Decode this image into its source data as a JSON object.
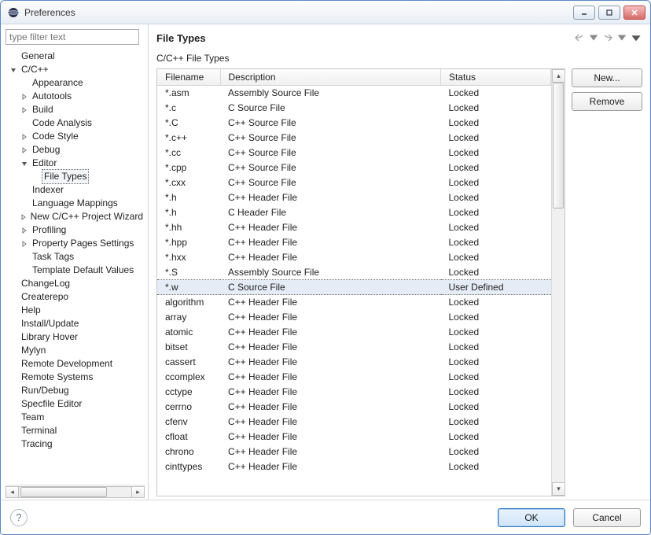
{
  "window": {
    "title": "Preferences"
  },
  "filter": {
    "placeholder": "type filter text"
  },
  "tree": [
    {
      "label": "General",
      "level": 1,
      "expander": "none"
    },
    {
      "label": "C/C++",
      "level": 1,
      "expander": "open"
    },
    {
      "label": "Appearance",
      "level": 2,
      "expander": "none"
    },
    {
      "label": "Autotools",
      "level": 2,
      "expander": "closed"
    },
    {
      "label": "Build",
      "level": 2,
      "expander": "closed"
    },
    {
      "label": "Code Analysis",
      "level": 2,
      "expander": "none"
    },
    {
      "label": "Code Style",
      "level": 2,
      "expander": "closed"
    },
    {
      "label": "Debug",
      "level": 2,
      "expander": "closed"
    },
    {
      "label": "Editor",
      "level": 2,
      "expander": "open"
    },
    {
      "label": "File Types",
      "level": 3,
      "expander": "none",
      "selected": true
    },
    {
      "label": "Indexer",
      "level": 2,
      "expander": "none"
    },
    {
      "label": "Language Mappings",
      "level": 2,
      "expander": "none"
    },
    {
      "label": "New C/C++ Project Wizard",
      "level": 2,
      "expander": "closed"
    },
    {
      "label": "Profiling",
      "level": 2,
      "expander": "closed"
    },
    {
      "label": "Property Pages Settings",
      "level": 2,
      "expander": "closed"
    },
    {
      "label": "Task Tags",
      "level": 2,
      "expander": "none"
    },
    {
      "label": "Template Default Values",
      "level": 2,
      "expander": "none"
    },
    {
      "label": "ChangeLog",
      "level": 1,
      "expander": "none"
    },
    {
      "label": "Createrepo",
      "level": 1,
      "expander": "none"
    },
    {
      "label": "Help",
      "level": 1,
      "expander": "none"
    },
    {
      "label": "Install/Update",
      "level": 1,
      "expander": "none"
    },
    {
      "label": "Library Hover",
      "level": 1,
      "expander": "none"
    },
    {
      "label": "Mylyn",
      "level": 1,
      "expander": "none"
    },
    {
      "label": "Remote Development",
      "level": 1,
      "expander": "none"
    },
    {
      "label": "Remote Systems",
      "level": 1,
      "expander": "none"
    },
    {
      "label": "Run/Debug",
      "level": 1,
      "expander": "none"
    },
    {
      "label": "Specfile Editor",
      "level": 1,
      "expander": "none"
    },
    {
      "label": "Team",
      "level": 1,
      "expander": "none"
    },
    {
      "label": "Terminal",
      "level": 1,
      "expander": "none"
    },
    {
      "label": "Tracing",
      "level": 1,
      "expander": "none"
    }
  ],
  "page": {
    "title": "File Types",
    "subtitle": "C/C++ File Types",
    "columns": {
      "filename": "Filename",
      "description": "Description",
      "status": "Status"
    },
    "rows": [
      {
        "filename": "*.asm",
        "description": "Assembly Source File",
        "status": "Locked"
      },
      {
        "filename": "*.c",
        "description": "C Source File",
        "status": "Locked"
      },
      {
        "filename": "*.C",
        "description": "C++ Source File",
        "status": "Locked"
      },
      {
        "filename": "*.c++",
        "description": "C++ Source File",
        "status": "Locked"
      },
      {
        "filename": "*.cc",
        "description": "C++ Source File",
        "status": "Locked"
      },
      {
        "filename": "*.cpp",
        "description": "C++ Source File",
        "status": "Locked"
      },
      {
        "filename": "*.cxx",
        "description": "C++ Source File",
        "status": "Locked"
      },
      {
        "filename": "*.h",
        "description": "C++ Header File",
        "status": "Locked"
      },
      {
        "filename": "*.h",
        "description": "C Header File",
        "status": "Locked"
      },
      {
        "filename": "*.hh",
        "description": "C++ Header File",
        "status": "Locked"
      },
      {
        "filename": "*.hpp",
        "description": "C++ Header File",
        "status": "Locked"
      },
      {
        "filename": "*.hxx",
        "description": "C++ Header File",
        "status": "Locked"
      },
      {
        "filename": "*.S",
        "description": "Assembly Source File",
        "status": "Locked"
      },
      {
        "filename": "*.w",
        "description": "C Source File",
        "status": "User Defined",
        "selected": true
      },
      {
        "filename": "algorithm",
        "description": "C++ Header File",
        "status": "Locked"
      },
      {
        "filename": "array",
        "description": "C++ Header File",
        "status": "Locked"
      },
      {
        "filename": "atomic",
        "description": "C++ Header File",
        "status": "Locked"
      },
      {
        "filename": "bitset",
        "description": "C++ Header File",
        "status": "Locked"
      },
      {
        "filename": "cassert",
        "description": "C++ Header File",
        "status": "Locked"
      },
      {
        "filename": "ccomplex",
        "description": "C++ Header File",
        "status": "Locked"
      },
      {
        "filename": "cctype",
        "description": "C++ Header File",
        "status": "Locked"
      },
      {
        "filename": "cerrno",
        "description": "C++ Header File",
        "status": "Locked"
      },
      {
        "filename": "cfenv",
        "description": "C++ Header File",
        "status": "Locked"
      },
      {
        "filename": "cfloat",
        "description": "C++ Header File",
        "status": "Locked"
      },
      {
        "filename": "chrono",
        "description": "C++ Header File",
        "status": "Locked"
      },
      {
        "filename": "cinttypes",
        "description": "C++ Header File",
        "status": "Locked"
      }
    ],
    "buttons": {
      "new": "New...",
      "remove": "Remove"
    }
  },
  "footer": {
    "ok": "OK",
    "cancel": "Cancel"
  }
}
